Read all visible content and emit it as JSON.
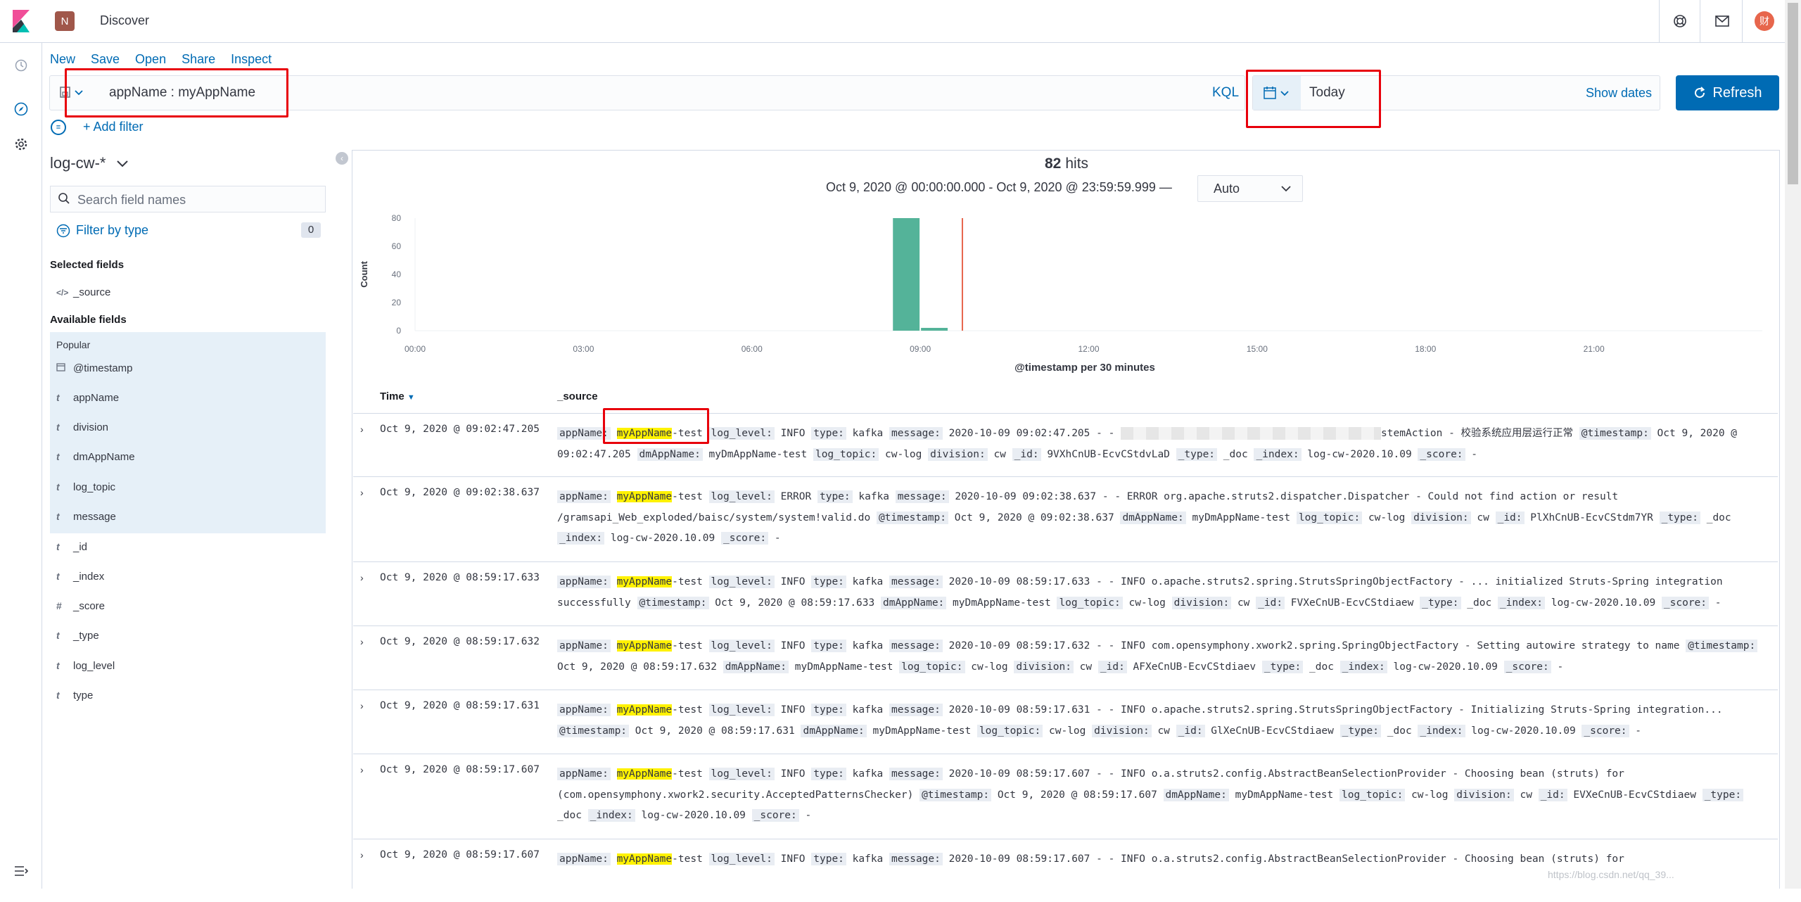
{
  "header": {
    "space_initial": "N",
    "app_title": "Discover",
    "avatar_initial": "财"
  },
  "menu": {
    "new": "New",
    "save": "Save",
    "open": "Open",
    "share": "Share",
    "inspect": "Inspect"
  },
  "query": {
    "text": "appName : myAppName",
    "language": "KQL"
  },
  "time": {
    "range_label": "Today",
    "show_dates": "Show dates",
    "refresh_label": "Refresh"
  },
  "filter": {
    "add_label": "+ Add filter"
  },
  "sidebar": {
    "index_pattern": "log-cw-*",
    "search_placeholder": "Search field names",
    "filter_by_type": "Filter by type",
    "filter_count": "0",
    "selected_title": "Selected fields",
    "selected_fields": [
      {
        "type_icon": "</>",
        "name": "_source"
      }
    ],
    "available_title": "Available fields",
    "popular_title": "Popular",
    "popular_fields": [
      {
        "type_icon": "calendar",
        "name": "@timestamp"
      },
      {
        "type_icon": "t",
        "name": "appName"
      },
      {
        "type_icon": "t",
        "name": "division"
      },
      {
        "type_icon": "t",
        "name": "dmAppName"
      },
      {
        "type_icon": "t",
        "name": "log_topic"
      },
      {
        "type_icon": "t",
        "name": "message"
      }
    ],
    "other_fields": [
      {
        "type_icon": "t",
        "name": "_id"
      },
      {
        "type_icon": "t",
        "name": "_index"
      },
      {
        "type_icon": "#",
        "name": "_score"
      },
      {
        "type_icon": "t",
        "name": "_type"
      },
      {
        "type_icon": "t",
        "name": "log_level"
      },
      {
        "type_icon": "t",
        "name": "type"
      }
    ]
  },
  "histogram": {
    "hits_count": "82",
    "hits_label": "hits",
    "date_range": "Oct 9, 2020 @ 00:00:00.000 - Oct 9, 2020 @ 23:59:59.999 —",
    "interval": "Auto"
  },
  "chart_data": {
    "type": "bar",
    "ylabel": "Count",
    "xlabel": "@timestamp per 30 minutes",
    "ylim": [
      0,
      80
    ],
    "yticks": [
      "0",
      "20",
      "40",
      "60",
      "80"
    ],
    "xticks": [
      "00:00",
      "03:00",
      "06:00",
      "09:00",
      "12:00",
      "15:00",
      "18:00",
      "21:00"
    ],
    "series": [
      {
        "values": [
          {
            "x": "08:30",
            "y": 80
          },
          {
            "x": "09:00",
            "y": 2
          }
        ]
      }
    ],
    "color": "#54b399",
    "now_marker_color": "#e7664c"
  },
  "table": {
    "col_time": "Time",
    "col_source": "_source",
    "rows": [
      {
        "time": "Oct 9, 2020 @ 09:02:47.205",
        "parts": [
          [
            "appName:",
            "myAppName",
            "-test"
          ],
          [
            "log_level:",
            "INFO"
          ],
          [
            "type:",
            "kafka"
          ],
          [
            "message:",
            "2020-10-09 09:02:47.205 - - ",
            "BLUR",
            "stemAction - 校验系统应用层运行正常"
          ],
          [
            "@timestamp:",
            "Oct 9, 2020 @ 09:02:47.205"
          ],
          [
            "dmAppName:",
            "myDmAppName-test"
          ],
          [
            "log_topic:",
            "cw-log"
          ],
          [
            "division:",
            "cw"
          ],
          [
            "_id:",
            "9VXhCnUB-EcvCStdvLaD"
          ],
          [
            "_type:",
            "_doc"
          ],
          [
            "_index:",
            "log-cw-2020.10.09"
          ],
          [
            "_score:",
            "-"
          ]
        ]
      },
      {
        "time": "Oct 9, 2020 @ 09:02:38.637",
        "parts": [
          [
            "appName:",
            "myAppName",
            "-test"
          ],
          [
            "log_level:",
            "ERROR"
          ],
          [
            "type:",
            "kafka"
          ],
          [
            "message:",
            "2020-10-09 09:02:38.637 - - ERROR org.apache.struts2.dispatcher.Dispatcher - Could not find action or result /gramsapi_Web_exploded/baisc/system/system!valid.do"
          ],
          [
            "@timestamp:",
            "Oct 9, 2020 @ 09:02:38.637"
          ],
          [
            "dmAppName:",
            "myDmAppName-test"
          ],
          [
            "log_topic:",
            "cw-log"
          ],
          [
            "division:",
            "cw"
          ],
          [
            "_id:",
            "PlXhCnUB-EcvCStdm7YR"
          ],
          [
            "_type:",
            "_doc"
          ],
          [
            "_index:",
            "log-cw-2020.10.09"
          ],
          [
            "_score:",
            "-"
          ]
        ]
      },
      {
        "time": "Oct 9, 2020 @ 08:59:17.633",
        "parts": [
          [
            "appName:",
            "myAppName",
            "-test"
          ],
          [
            "log_level:",
            "INFO"
          ],
          [
            "type:",
            "kafka"
          ],
          [
            "message:",
            "2020-10-09 08:59:17.633 - - INFO o.apache.struts2.spring.StrutsSpringObjectFactory - ... initialized Struts-Spring integration successfully"
          ],
          [
            "@timestamp:",
            "Oct 9, 2020 @ 08:59:17.633"
          ],
          [
            "dmAppName:",
            "myDmAppName-test"
          ],
          [
            "log_topic:",
            "cw-log"
          ],
          [
            "division:",
            "cw"
          ],
          [
            "_id:",
            "FVXeCnUB-EcvCStdiaew"
          ],
          [
            "_type:",
            "_doc"
          ],
          [
            "_index:",
            "log-cw-2020.10.09"
          ],
          [
            "_score:",
            "-"
          ]
        ]
      },
      {
        "time": "Oct 9, 2020 @ 08:59:17.632",
        "parts": [
          [
            "appName:",
            "myAppName",
            "-test"
          ],
          [
            "log_level:",
            "INFO"
          ],
          [
            "type:",
            "kafka"
          ],
          [
            "message:",
            "2020-10-09 08:59:17.632 - - INFO com.opensymphony.xwork2.spring.SpringObjectFactory - Setting autowire strategy to name"
          ],
          [
            "@timestamp:",
            "Oct 9, 2020 @ 08:59:17.632"
          ],
          [
            "dmAppName:",
            "myDmAppName-test"
          ],
          [
            "log_topic:",
            "cw-log"
          ],
          [
            "division:",
            "cw"
          ],
          [
            "_id:",
            "AFXeCnUB-EcvCStdiaev"
          ],
          [
            "_type:",
            "_doc"
          ],
          [
            "_index:",
            "log-cw-2020.10.09"
          ],
          [
            "_score:",
            "-"
          ]
        ]
      },
      {
        "time": "Oct 9, 2020 @ 08:59:17.631",
        "parts": [
          [
            "appName:",
            "myAppName",
            "-test"
          ],
          [
            "log_level:",
            "INFO"
          ],
          [
            "type:",
            "kafka"
          ],
          [
            "message:",
            "2020-10-09 08:59:17.631 - - INFO o.apache.struts2.spring.StrutsSpringObjectFactory - Initializing Struts-Spring integration..."
          ],
          [
            "@timestamp:",
            "Oct 9, 2020 @ 08:59:17.631"
          ],
          [
            "dmAppName:",
            "myDmAppName-test"
          ],
          [
            "log_topic:",
            "cw-log"
          ],
          [
            "division:",
            "cw"
          ],
          [
            "_id:",
            "GlXeCnUB-EcvCStdiaew"
          ],
          [
            "_type:",
            "_doc"
          ],
          [
            "_index:",
            "log-cw-2020.10.09"
          ],
          [
            "_score:",
            "-"
          ]
        ]
      },
      {
        "time": "Oct 9, 2020 @ 08:59:17.607",
        "parts": [
          [
            "appName:",
            "myAppName",
            "-test"
          ],
          [
            "log_level:",
            "INFO"
          ],
          [
            "type:",
            "kafka"
          ],
          [
            "message:",
            "2020-10-09 08:59:17.607 - - INFO o.a.struts2.config.AbstractBeanSelectionProvider - Choosing bean (struts) for (com.opensymphony.xwork2.security.AcceptedPatternsChecker)"
          ],
          [
            "@timestamp:",
            "Oct 9, 2020 @ 08:59:17.607"
          ],
          [
            "dmAppName:",
            "myDmAppName-test"
          ],
          [
            "log_topic:",
            "cw-log"
          ],
          [
            "division:",
            "cw"
          ],
          [
            "_id:",
            "EVXeCnUB-EcvCStdiaew"
          ],
          [
            "_type:",
            "_doc"
          ],
          [
            "_index:",
            "log-cw-2020.10.09"
          ],
          [
            "_score:",
            "-"
          ]
        ]
      },
      {
        "time": "Oct 9, 2020 @ 08:59:17.607",
        "parts": [
          [
            "appName:",
            "myAppName",
            "-test"
          ],
          [
            "log_level:",
            "INFO"
          ],
          [
            "type:",
            "kafka"
          ],
          [
            "message:",
            "2020-10-09 08:59:17.607 - - INFO o.a.struts2.config.AbstractBeanSelectionProvider - Choosing bean (struts) for"
          ]
        ]
      }
    ]
  },
  "watermark": "https://blog.csdn.net/qq_39..."
}
